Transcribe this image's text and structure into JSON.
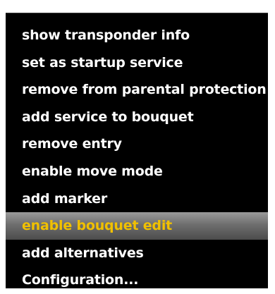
{
  "menu": {
    "items": [
      {
        "label": "show transponder info",
        "selected": false
      },
      {
        "label": "set as startup service",
        "selected": false
      },
      {
        "label": "remove from parental protection",
        "selected": false
      },
      {
        "label": "add service to bouquet",
        "selected": false
      },
      {
        "label": "remove entry",
        "selected": false
      },
      {
        "label": "enable move mode",
        "selected": false
      },
      {
        "label": "add marker",
        "selected": false
      },
      {
        "label": "enable bouquet edit",
        "selected": true
      },
      {
        "label": "add alternatives",
        "selected": false
      },
      {
        "label": "Configuration...",
        "selected": false
      }
    ]
  },
  "colors": {
    "background": "#000000",
    "text": "#ffffff",
    "selected_text": "#f0c000",
    "selected_bar": "#6e6e6e"
  }
}
